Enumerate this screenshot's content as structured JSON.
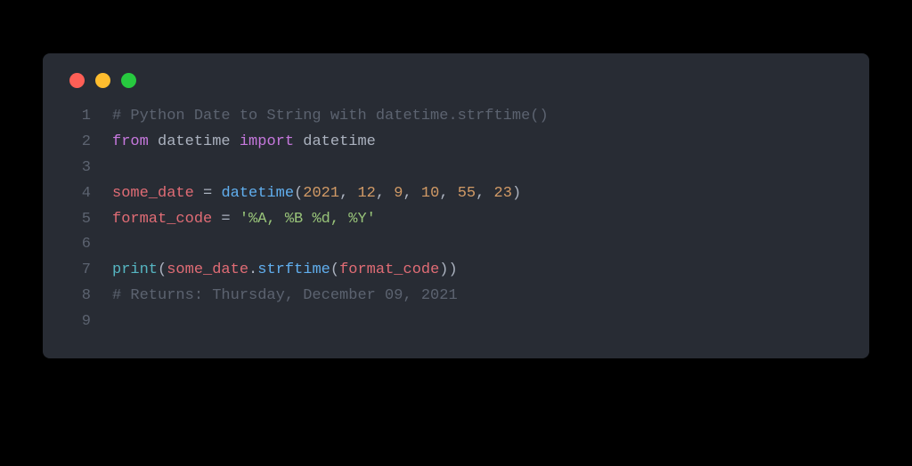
{
  "colors": {
    "background": "#000000",
    "window_bg": "#282c34",
    "gutter": "#5c6370",
    "red": "#ff5f56",
    "yellow": "#ffbd2e",
    "green": "#27c93f"
  },
  "code": {
    "lines": [
      {
        "n": "1",
        "tokens": [
          {
            "t": "# Python Date to String with datetime.strftime()",
            "cls": "comment"
          }
        ]
      },
      {
        "n": "2",
        "tokens": [
          {
            "t": "from",
            "cls": "keyword"
          },
          {
            "t": " ",
            "cls": "default"
          },
          {
            "t": "datetime",
            "cls": "default"
          },
          {
            "t": " ",
            "cls": "default"
          },
          {
            "t": "import",
            "cls": "keyword"
          },
          {
            "t": " ",
            "cls": "default"
          },
          {
            "t": "datetime",
            "cls": "default"
          }
        ]
      },
      {
        "n": "3",
        "tokens": []
      },
      {
        "n": "4",
        "tokens": [
          {
            "t": "some_date",
            "cls": "variable"
          },
          {
            "t": " ",
            "cls": "default"
          },
          {
            "t": "=",
            "cls": "punct"
          },
          {
            "t": " ",
            "cls": "default"
          },
          {
            "t": "datetime",
            "cls": "function"
          },
          {
            "t": "(",
            "cls": "punct"
          },
          {
            "t": "2021",
            "cls": "number"
          },
          {
            "t": ",",
            "cls": "punct"
          },
          {
            "t": " ",
            "cls": "default"
          },
          {
            "t": "12",
            "cls": "number"
          },
          {
            "t": ",",
            "cls": "punct"
          },
          {
            "t": " ",
            "cls": "default"
          },
          {
            "t": "9",
            "cls": "number"
          },
          {
            "t": ",",
            "cls": "punct"
          },
          {
            "t": " ",
            "cls": "default"
          },
          {
            "t": "10",
            "cls": "number"
          },
          {
            "t": ",",
            "cls": "punct"
          },
          {
            "t": " ",
            "cls": "default"
          },
          {
            "t": "55",
            "cls": "number"
          },
          {
            "t": ",",
            "cls": "punct"
          },
          {
            "t": " ",
            "cls": "default"
          },
          {
            "t": "23",
            "cls": "number"
          },
          {
            "t": ")",
            "cls": "punct"
          }
        ]
      },
      {
        "n": "5",
        "tokens": [
          {
            "t": "format_code",
            "cls": "variable"
          },
          {
            "t": " ",
            "cls": "default"
          },
          {
            "t": "=",
            "cls": "punct"
          },
          {
            "t": " ",
            "cls": "default"
          },
          {
            "t": "'%A, %B %d, %Y'",
            "cls": "string"
          }
        ]
      },
      {
        "n": "6",
        "tokens": []
      },
      {
        "n": "7",
        "tokens": [
          {
            "t": "print",
            "cls": "builtin"
          },
          {
            "t": "(",
            "cls": "punct"
          },
          {
            "t": "some_date",
            "cls": "variable"
          },
          {
            "t": ".",
            "cls": "punct"
          },
          {
            "t": "strftime",
            "cls": "function"
          },
          {
            "t": "(",
            "cls": "punct"
          },
          {
            "t": "format_code",
            "cls": "variable"
          },
          {
            "t": ")",
            "cls": "punct"
          },
          {
            "t": ")",
            "cls": "punct"
          }
        ]
      },
      {
        "n": "8",
        "tokens": [
          {
            "t": "# Returns: Thursday, December 09, 2021",
            "cls": "comment"
          }
        ]
      },
      {
        "n": "9",
        "tokens": []
      }
    ]
  }
}
